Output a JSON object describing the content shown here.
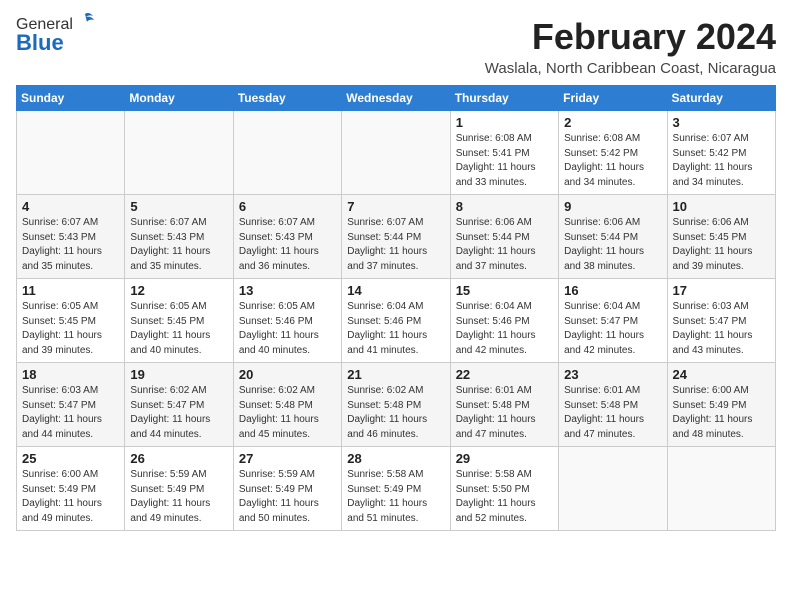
{
  "header": {
    "logo_general": "General",
    "logo_blue": "Blue",
    "month_title": "February 2024",
    "location": "Waslala, North Caribbean Coast, Nicaragua"
  },
  "weekdays": [
    "Sunday",
    "Monday",
    "Tuesday",
    "Wednesday",
    "Thursday",
    "Friday",
    "Saturday"
  ],
  "weeks": [
    [
      {
        "day": "",
        "info": ""
      },
      {
        "day": "",
        "info": ""
      },
      {
        "day": "",
        "info": ""
      },
      {
        "day": "",
        "info": ""
      },
      {
        "day": "1",
        "info": "Sunrise: 6:08 AM\nSunset: 5:41 PM\nDaylight: 11 hours\nand 33 minutes."
      },
      {
        "day": "2",
        "info": "Sunrise: 6:08 AM\nSunset: 5:42 PM\nDaylight: 11 hours\nand 34 minutes."
      },
      {
        "day": "3",
        "info": "Sunrise: 6:07 AM\nSunset: 5:42 PM\nDaylight: 11 hours\nand 34 minutes."
      }
    ],
    [
      {
        "day": "4",
        "info": "Sunrise: 6:07 AM\nSunset: 5:43 PM\nDaylight: 11 hours\nand 35 minutes."
      },
      {
        "day": "5",
        "info": "Sunrise: 6:07 AM\nSunset: 5:43 PM\nDaylight: 11 hours\nand 35 minutes."
      },
      {
        "day": "6",
        "info": "Sunrise: 6:07 AM\nSunset: 5:43 PM\nDaylight: 11 hours\nand 36 minutes."
      },
      {
        "day": "7",
        "info": "Sunrise: 6:07 AM\nSunset: 5:44 PM\nDaylight: 11 hours\nand 37 minutes."
      },
      {
        "day": "8",
        "info": "Sunrise: 6:06 AM\nSunset: 5:44 PM\nDaylight: 11 hours\nand 37 minutes."
      },
      {
        "day": "9",
        "info": "Sunrise: 6:06 AM\nSunset: 5:44 PM\nDaylight: 11 hours\nand 38 minutes."
      },
      {
        "day": "10",
        "info": "Sunrise: 6:06 AM\nSunset: 5:45 PM\nDaylight: 11 hours\nand 39 minutes."
      }
    ],
    [
      {
        "day": "11",
        "info": "Sunrise: 6:05 AM\nSunset: 5:45 PM\nDaylight: 11 hours\nand 39 minutes."
      },
      {
        "day": "12",
        "info": "Sunrise: 6:05 AM\nSunset: 5:45 PM\nDaylight: 11 hours\nand 40 minutes."
      },
      {
        "day": "13",
        "info": "Sunrise: 6:05 AM\nSunset: 5:46 PM\nDaylight: 11 hours\nand 40 minutes."
      },
      {
        "day": "14",
        "info": "Sunrise: 6:04 AM\nSunset: 5:46 PM\nDaylight: 11 hours\nand 41 minutes."
      },
      {
        "day": "15",
        "info": "Sunrise: 6:04 AM\nSunset: 5:46 PM\nDaylight: 11 hours\nand 42 minutes."
      },
      {
        "day": "16",
        "info": "Sunrise: 6:04 AM\nSunset: 5:47 PM\nDaylight: 11 hours\nand 42 minutes."
      },
      {
        "day": "17",
        "info": "Sunrise: 6:03 AM\nSunset: 5:47 PM\nDaylight: 11 hours\nand 43 minutes."
      }
    ],
    [
      {
        "day": "18",
        "info": "Sunrise: 6:03 AM\nSunset: 5:47 PM\nDaylight: 11 hours\nand 44 minutes."
      },
      {
        "day": "19",
        "info": "Sunrise: 6:02 AM\nSunset: 5:47 PM\nDaylight: 11 hours\nand 44 minutes."
      },
      {
        "day": "20",
        "info": "Sunrise: 6:02 AM\nSunset: 5:48 PM\nDaylight: 11 hours\nand 45 minutes."
      },
      {
        "day": "21",
        "info": "Sunrise: 6:02 AM\nSunset: 5:48 PM\nDaylight: 11 hours\nand 46 minutes."
      },
      {
        "day": "22",
        "info": "Sunrise: 6:01 AM\nSunset: 5:48 PM\nDaylight: 11 hours\nand 47 minutes."
      },
      {
        "day": "23",
        "info": "Sunrise: 6:01 AM\nSunset: 5:48 PM\nDaylight: 11 hours\nand 47 minutes."
      },
      {
        "day": "24",
        "info": "Sunrise: 6:00 AM\nSunset: 5:49 PM\nDaylight: 11 hours\nand 48 minutes."
      }
    ],
    [
      {
        "day": "25",
        "info": "Sunrise: 6:00 AM\nSunset: 5:49 PM\nDaylight: 11 hours\nand 49 minutes."
      },
      {
        "day": "26",
        "info": "Sunrise: 5:59 AM\nSunset: 5:49 PM\nDaylight: 11 hours\nand 49 minutes."
      },
      {
        "day": "27",
        "info": "Sunrise: 5:59 AM\nSunset: 5:49 PM\nDaylight: 11 hours\nand 50 minutes."
      },
      {
        "day": "28",
        "info": "Sunrise: 5:58 AM\nSunset: 5:49 PM\nDaylight: 11 hours\nand 51 minutes."
      },
      {
        "day": "29",
        "info": "Sunrise: 5:58 AM\nSunset: 5:50 PM\nDaylight: 11 hours\nand 52 minutes."
      },
      {
        "day": "",
        "info": ""
      },
      {
        "day": "",
        "info": ""
      }
    ]
  ]
}
